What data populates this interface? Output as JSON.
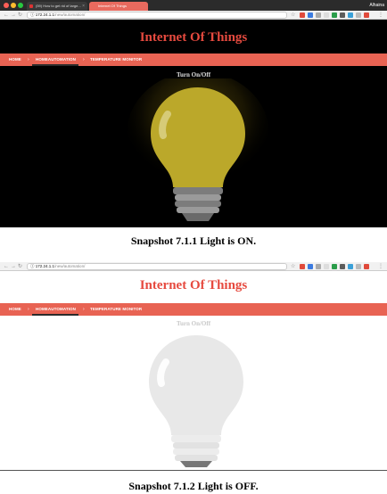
{
  "screens": [
    {
      "tab_title": "(59) How to get rid of large...",
      "new_tab_title": "Internet Of Things",
      "profile": "Alhaina",
      "url_host": "172.24.1.1",
      "url_path": "/new/automation/",
      "app_title": "Internet Of Things",
      "nav": [
        "HOME",
        "HOMEAUTOMATION",
        "TEMPERATURE MONITOR"
      ],
      "toggle_label": "Turn On/Off",
      "light_state": "on"
    },
    {
      "url_host": "172.24.1.1",
      "url_path": "/new/automation/",
      "app_title": "Internet Of Things",
      "nav": [
        "HOME",
        "HOMEAUTOMATION",
        "TEMPERATURE MONITOR"
      ],
      "toggle_label": "Turn On/Off",
      "light_state": "off"
    }
  ],
  "captions": [
    "Snapshot 7.1.1 Light is ON.",
    "Snapshot 7.1.2 Light is OFF."
  ],
  "colors": {
    "title": "#e64a3f",
    "nav_bar": "#e86353",
    "bulb_on": "#bba82a",
    "bulb_glow": "#5a4d0a",
    "bulb_off": "#e8e8e8"
  },
  "icons": {
    "back": "arrow-left-icon",
    "forward": "arrow-right-icon",
    "reload": "reload-icon",
    "info": "info-icon",
    "bookmark": "star-icon"
  }
}
